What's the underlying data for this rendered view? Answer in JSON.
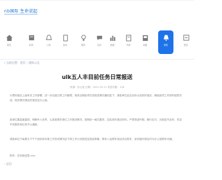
{
  "site": {
    "logo_text": "nb国际 生命说起"
  },
  "nav": {
    "items": [
      {
        "label": "首页",
        "icon": "home-icon"
      },
      {
        "label": "新闻",
        "icon": "news-icon"
      },
      {
        "label": "公告",
        "icon": "bell-icon"
      },
      {
        "label": "政务",
        "icon": "building-icon"
      },
      {
        "label": "服务",
        "icon": "service-icon"
      },
      {
        "label": "互动",
        "icon": "chat-icon"
      },
      {
        "label": "数据",
        "icon": "chart-icon"
      },
      {
        "label": "专题",
        "icon": "book-icon"
      },
      {
        "label": "地图",
        "icon": "map-icon"
      },
      {
        "label": "通知",
        "icon": "bell-active-icon"
      },
      {
        "label": "更多",
        "icon": "more-icon"
      }
    ],
    "active_index": 9
  },
  "breadcrumb": {
    "arrow": "‹",
    "text": "当前位置：首页 › 通知公告"
  },
  "article": {
    "title": "ulk五人丰目前任务日常报送",
    "meta": "来源：办公室   日期：2023-05-12   浏览次数：128",
    "paragraphs": [
      "为贯彻落实上级有关工作部署，进一步加强日常工作管理，现将近期各项任务报送情况通知如下，请各单位结合实际认真抓好落实，确保各项工作按时保质完成，相关情况请及时报送至办公室。",
      "各单位要高度重视，明确专人负责，认真梳理本单位工作推进情况，按照统一格式要求，如实填写报送材料，严禁弄虚作假、敷衍应付，对报送不及时、内容不完整的单位将予以通报。",
      "请各单位于每周五下午下班前将本周工作完成情况及下周工作计划报送至指定邮箱，联系人及联系电话详见附件，如有疑问请及时与办公室联系沟通。"
    ],
    "footnote": "附件：任务报送表.xlsx"
  },
  "footer": {
    "text": "‹ 返回"
  }
}
